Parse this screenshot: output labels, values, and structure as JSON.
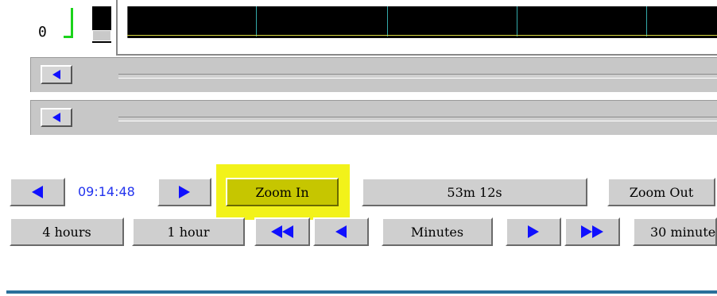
{
  "meter": {
    "zero_label": "0"
  },
  "nav_row": {
    "time_value": "09:14:48",
    "zoom_in_label": "Zoom In",
    "duration_label": "53m 12s",
    "zoom_out_label": "Zoom Out"
  },
  "range_row": {
    "four_hours_label": "4 hours",
    "one_hour_label": "1 hour",
    "minutes_label": "Minutes",
    "thirty_minutes_label": "30 minute"
  },
  "colors": {
    "arrow": "#1010ff",
    "highlight": "#f2f21a",
    "time_text": "#2233ee",
    "plot_background": "#000000",
    "grid_line": "#33aaaa",
    "trace_line": "#d8d840",
    "bottom_rule": "#2a6f9a"
  },
  "icons": {
    "scroll_left": "left-triangle-icon",
    "step_back": "left-triangle-icon",
    "step_forward": "right-triangle-icon",
    "fast_back": "double-left-triangle-icon",
    "fast_forward": "double-right-triangle-icon"
  }
}
